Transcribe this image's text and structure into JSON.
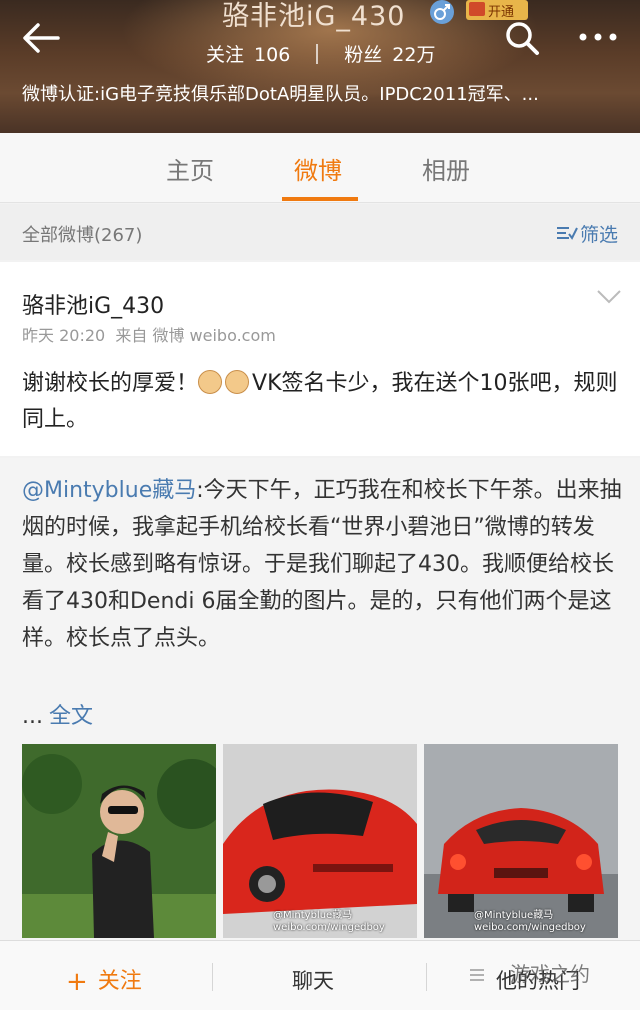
{
  "profile": {
    "name": "骆非池iG_430",
    "vip_label": "开通",
    "following_label": "关注",
    "following_count": "106",
    "followers_label": "粉丝",
    "followers_count": "22万",
    "verification": "微博认证:iG电子竞技俱乐部DotA明星队员。IPDC2011冠军、..."
  },
  "tabs": [
    {
      "label": "主页",
      "active": false
    },
    {
      "label": "微博",
      "active": true
    },
    {
      "label": "相册",
      "active": false
    }
  ],
  "filter": {
    "all_label": "全部微博(267)",
    "filter_label": "筛选"
  },
  "post": {
    "author": "骆非池iG_430",
    "time": "昨天 20:20",
    "source": "来自 微博 weibo.com",
    "text_before_emoji": "谢谢校长的厚爱！",
    "text_after_emoji": "VK签名卡少，我在送个10张吧，规则同上。"
  },
  "retweet": {
    "mention": "@Mintyblue藏马",
    "text": ":今天下午，正巧我在和校长下午茶。出来抽烟的时候，我拿起手机给校长看“世界小碧池日”微博的转发量。校长感到略有惊讶。于是我们聊起了430。我顺便给校长看了430和Dendi 6届全勤的图片。是的，只有他们两个是这样。校长点了点头。",
    "ellipsis": "...",
    "full_text_link": "全文",
    "image_watermark_1": "@Mintyblue藏马",
    "image_watermark_2": "weibo.com/wingedboy"
  },
  "bottom_bar": {
    "follow": "关注",
    "chat": "聊天",
    "hot": "他的热门"
  },
  "corner_watermark": "游戏之约",
  "colors": {
    "accent": "#f07a10",
    "link": "#4a7bb0"
  }
}
